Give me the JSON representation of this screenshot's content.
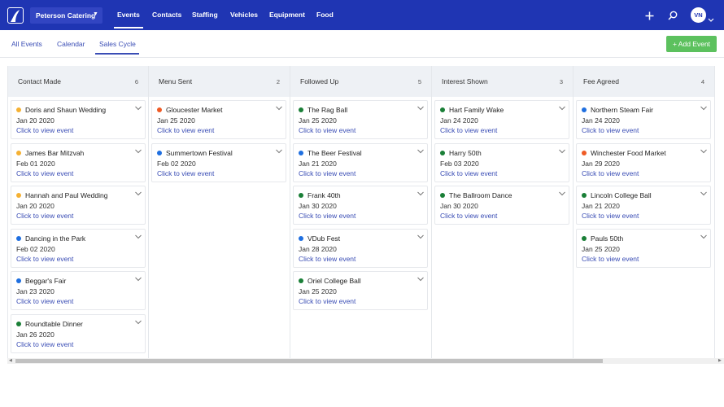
{
  "colors": {
    "topbar": "#1f35b3",
    "accent": "#3a4db5",
    "add_button": "#5cc15e",
    "dot_yellow": "#f5b133",
    "dot_blue": "#1f6fe0",
    "dot_green": "#1a7f37",
    "dot_orange": "#ef5b25"
  },
  "header": {
    "logo_icon": "brand-logo",
    "org_selector": "Peterson Catering",
    "nav": [
      "Events",
      "Contacts",
      "Staffing",
      "Vehicles",
      "Equipment",
      "Food"
    ],
    "active_nav": "Events",
    "icons": [
      "plus-icon",
      "search-icon",
      "chevron-down-icon"
    ],
    "user_initials": "VN"
  },
  "subnav": {
    "tabs": [
      "All Events",
      "Calendar",
      "Sales Cycle"
    ],
    "active_tab": "Sales Cycle",
    "add_button": "+ Add Event"
  },
  "board": {
    "link_text": "Click to view event",
    "columns": [
      {
        "title": "Contact Made",
        "count": "6",
        "cards": [
          {
            "title": "Doris and Shaun Wedding",
            "date": "Jan 20 2020",
            "dot": "yellow"
          },
          {
            "title": "James Bar Mitzvah",
            "date": "Feb 01 2020",
            "dot": "yellow"
          },
          {
            "title": "Hannah and Paul Wedding",
            "date": "Jan 20 2020",
            "dot": "yellow"
          },
          {
            "title": "Dancing in the Park",
            "date": "Feb 02 2020",
            "dot": "blue"
          },
          {
            "title": "Beggar's Fair",
            "date": "Jan 23 2020",
            "dot": "blue"
          },
          {
            "title": "Roundtable Dinner",
            "date": "Jan 26 2020",
            "dot": "green"
          }
        ]
      },
      {
        "title": "Menu Sent",
        "count": "2",
        "cards": [
          {
            "title": "Gloucester Market",
            "date": "Jan 25 2020",
            "dot": "orange"
          },
          {
            "title": "Summertown Festival",
            "date": "Feb 02 2020",
            "dot": "blue"
          }
        ]
      },
      {
        "title": "Followed Up",
        "count": "5",
        "cards": [
          {
            "title": "The Rag Ball",
            "date": "Jan 25 2020",
            "dot": "green"
          },
          {
            "title": "The Beer Festival",
            "date": "Jan 21 2020",
            "dot": "blue"
          },
          {
            "title": "Frank 40th",
            "date": "Jan 30 2020",
            "dot": "green"
          },
          {
            "title": "VDub Fest",
            "date": "Jan 28 2020",
            "dot": "blue"
          },
          {
            "title": "Oriel College Ball",
            "date": "Jan 25 2020",
            "dot": "green"
          }
        ]
      },
      {
        "title": "Interest Shown",
        "count": "3",
        "cards": [
          {
            "title": "Hart Family Wake",
            "date": "Jan 24 2020",
            "dot": "green"
          },
          {
            "title": "Harry 50th",
            "date": "Feb 03 2020",
            "dot": "green"
          },
          {
            "title": "The Ballroom Dance",
            "date": "Jan 30 2020",
            "dot": "green"
          }
        ]
      },
      {
        "title": "Fee Agreed",
        "count": "4",
        "cards": [
          {
            "title": "Northern Steam Fair",
            "date": "Jan 24 2020",
            "dot": "blue"
          },
          {
            "title": "Winchester Food Market",
            "date": "Jan 29 2020",
            "dot": "orange"
          },
          {
            "title": "Lincoln College Ball",
            "date": "Jan 21 2020",
            "dot": "green"
          },
          {
            "title": "Pauls 50th",
            "date": "Jan 25 2020",
            "dot": "green"
          }
        ]
      }
    ]
  }
}
